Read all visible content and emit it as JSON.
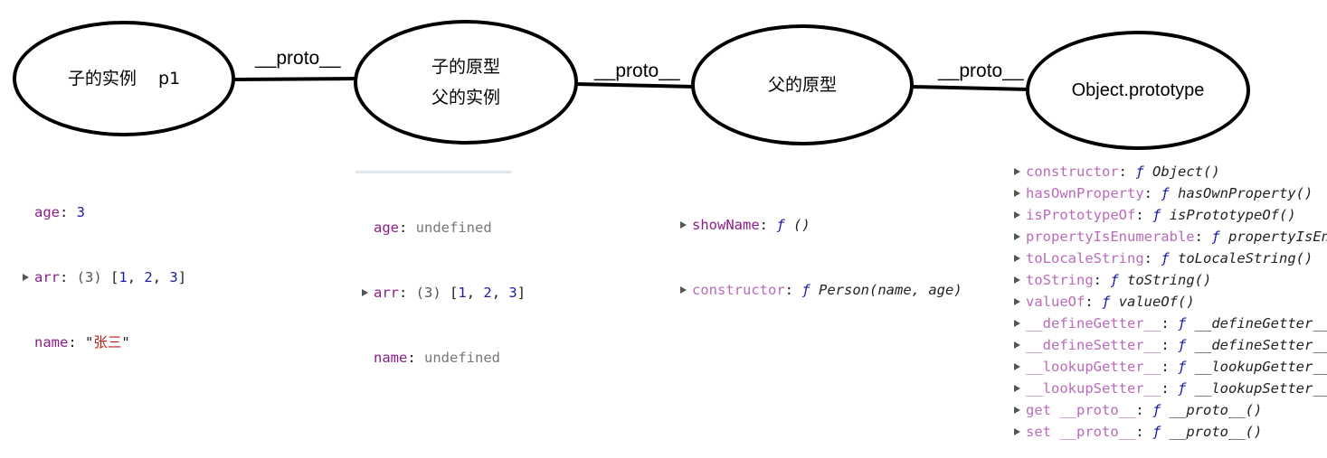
{
  "nodes": [
    {
      "id": "child-instance",
      "lines": [
        "子的实例    p1"
      ]
    },
    {
      "id": "child-prototype",
      "lines": [
        "子的原型",
        "父的实例"
      ]
    },
    {
      "id": "parent-prototype",
      "lines": [
        "父的原型"
      ]
    },
    {
      "id": "object-prototype",
      "lines": [
        "Object.prototype"
      ]
    }
  ],
  "edges": [
    {
      "from": "child-instance",
      "to": "child-prototype",
      "label": "__proto__"
    },
    {
      "from": "child-prototype",
      "to": "parent-prototype",
      "label": "__proto__"
    },
    {
      "from": "parent-prototype",
      "to": "object-prototype",
      "label": "__proto__"
    }
  ],
  "panels": {
    "child_instance": {
      "age_key": "age",
      "age_val": "3",
      "arr_key": "arr",
      "arr_count": "(3)",
      "arr_open": "[",
      "arr_v1": "1",
      "arr_v2": "2",
      "arr_v3": "3",
      "arr_close": "]",
      "name_key": "name",
      "name_val_open": "\"",
      "name_val": "张三",
      "name_val_close": "\""
    },
    "child_prototype": {
      "age_key": "age",
      "age_val": "undefined",
      "arr_key": "arr",
      "arr_count": "(3)",
      "arr_open": "[",
      "arr_v1": "1",
      "arr_v2": "2",
      "arr_v3": "3",
      "arr_close": "]",
      "name_key": "name",
      "name_val": "undefined"
    },
    "parent_prototype": [
      {
        "key": "showName",
        "f": "ƒ",
        "sig": "()"
      },
      {
        "key": "constructor",
        "f": "ƒ",
        "sig": "Person(name, age)"
      }
    ],
    "object_prototype": [
      {
        "key": "constructor",
        "f": "ƒ",
        "sig": "Object()"
      },
      {
        "key": "hasOwnProperty",
        "f": "ƒ",
        "sig": "hasOwnProperty()"
      },
      {
        "key": "isPrototypeOf",
        "f": "ƒ",
        "sig": "isPrototypeOf()"
      },
      {
        "key": "propertyIsEnumerable",
        "f": "ƒ",
        "sig": "propertyIsEnumerable()"
      },
      {
        "key": "toLocaleString",
        "f": "ƒ",
        "sig": "toLocaleString()"
      },
      {
        "key": "toString",
        "f": "ƒ",
        "sig": "toString()"
      },
      {
        "key": "valueOf",
        "f": "ƒ",
        "sig": "valueOf()"
      },
      {
        "key": "__defineGetter__",
        "f": "ƒ",
        "sig": "__defineGetter__()"
      },
      {
        "key": "__defineSetter__",
        "f": "ƒ",
        "sig": "__defineSetter__()"
      },
      {
        "key": "__lookupGetter__",
        "f": "ƒ",
        "sig": "__lookupGetter__()"
      },
      {
        "key": "__lookupSetter__",
        "f": "ƒ",
        "sig": "__lookupSetter__()"
      },
      {
        "key": "get __proto__",
        "f": "ƒ",
        "sig": "__proto__()"
      },
      {
        "key": "set __proto__",
        "f": "ƒ",
        "sig": "__proto__()"
      }
    ],
    "colors": {
      "key": "#8e1c8c",
      "number": "#1c1ca8",
      "string": "#c41a16",
      "undefined": "#777777",
      "function": "#1a1aa6"
    }
  }
}
